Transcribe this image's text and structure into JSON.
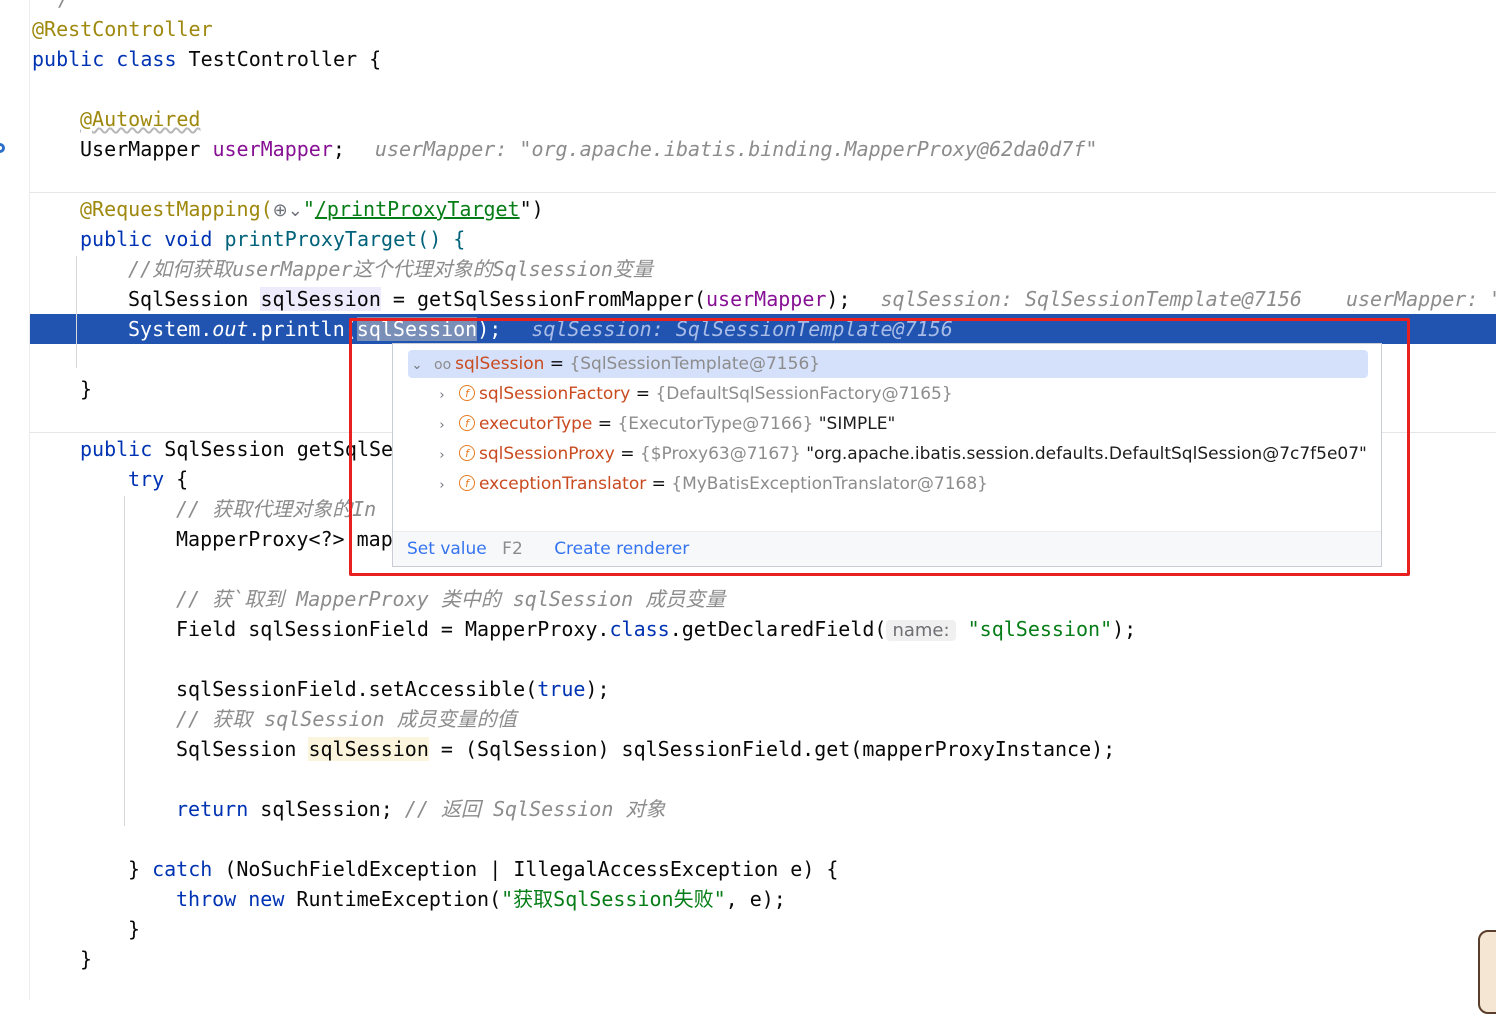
{
  "editor": {
    "lines": {
      "restcontroller": "@RestController",
      "class_decl_kw": "public class ",
      "class_name": "TestController {",
      "autowired": "@Autowired",
      "usermapper_type": "UserMapper ",
      "usermapper_field": "userMapper",
      "usermapper_semi": ";",
      "usermapper_hint": "userMapper: \"org.apache.ibatis.binding.MapperProxy@62da0d7f\"",
      "reqmap_ann": "@RequestMapping(",
      "reqmap_url": "/printProxyTarget",
      "reqmap_end": "\")",
      "method_kw": "public void ",
      "method_name": "printProxyTarget() {",
      "comment1": "//如何获取userMapper这个代理对象的Sqlsession变量",
      "sqls_type": "SqlSession ",
      "sqls_var": "sqlSession",
      "sqls_rest": " = getSqlSessionFromMapper(",
      "sqls_arg": "userMapper",
      "sqls_end": ");",
      "sqls_hint1": "sqlSession: SqlSessionTemplate@7156",
      "sqls_hint2": "userMapper: \"",
      "print_a": "System.",
      "print_out": "out",
      "print_b": ".println(",
      "print_arg": "sqlSession",
      "print_end": ");",
      "print_hint": "sqlSession: SqlSessionTemplate@7156",
      "close1": "}",
      "getsql_kw": "public ",
      "getsql_rest": "SqlSession getSqlSe",
      "try_kw": "try",
      "try_brace": " {",
      "comment2": "// 获取代理对象的In",
      "mapperproxy": "MapperProxy<?> map",
      "comment3": "// 获`取到 MapperProxy 类中的 sqlSession 成员变量",
      "field_a": "Field sqlSessionField = MapperProxy.",
      "field_class": "class",
      "field_b": ".getDeclaredField(",
      "field_hint": "name:",
      "field_str": "\"sqlSession\"",
      "field_end": ");",
      "setacc_a": "sqlSessionField.setAccessible(",
      "setacc_true": "true",
      "setacc_end": ");",
      "comment4": "// 获取 sqlSession 成员变量的值",
      "get_type": "SqlSession ",
      "get_var": "sqlSession",
      "get_rest": " = (SqlSession) sqlSessionField.get(mapperProxyInstance);",
      "ret_kw": "return",
      "ret_rest": " sqlSession; ",
      "ret_cmt": "// 返回 SqlSession 对象",
      "catch_a": "} ",
      "catch_kw": "catch",
      "catch_rest": " (NoSuchFieldException | IllegalAccessException e) {",
      "throw_kw": "throw",
      "new_kw": " new",
      "throw_rest": " RuntimeException(",
      "throw_str": "\"获取SqlSession失败\"",
      "throw_end": ", e);",
      "close2": "}",
      "close3": "}"
    }
  },
  "popup": {
    "root": {
      "name": "sqlSession",
      "eq": " = ",
      "type": "{SqlSessionTemplate@7156}"
    },
    "children": [
      {
        "name": "sqlSessionFactory",
        "type": "{DefaultSqlSessionFactory@7165}",
        "value": ""
      },
      {
        "name": "executorType",
        "type": "{ExecutorType@7166}",
        "value": " \"SIMPLE\""
      },
      {
        "name": "sqlSessionProxy",
        "type": "{$Proxy63@7167}",
        "value": " \"org.apache.ibatis.session.defaults.DefaultSqlSession@7c7f5e07\""
      },
      {
        "name": "exceptionTranslator",
        "type": "{MyBatisExceptionTranslator@7168}",
        "value": ""
      }
    ],
    "footer": {
      "set_value": "Set value",
      "set_value_key": "F2",
      "create_renderer": "Create renderer"
    }
  },
  "icons": {
    "expand": "chevron-down-icon",
    "collapse": "chevron-right-icon",
    "field": "field-icon",
    "watch": "glasses-icon",
    "globe": "globe-icon"
  },
  "colors": {
    "keyword": "#0033b3",
    "annotation": "#9e880d",
    "field": "#871094",
    "string": "#067d17",
    "comment": "#8c8c8c",
    "exec_line": "#2154b0",
    "highlight_box": "#e8201f",
    "link": "#3574f0"
  }
}
